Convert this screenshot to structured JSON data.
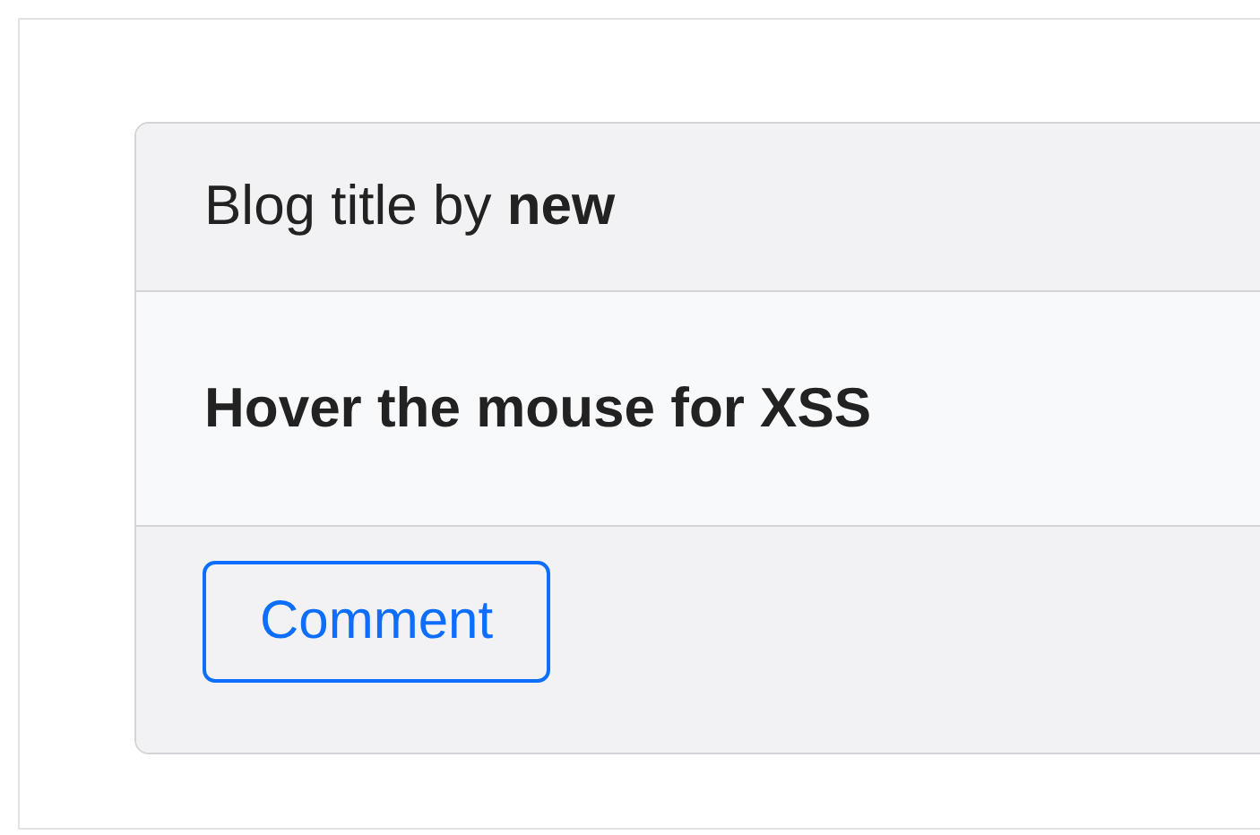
{
  "card": {
    "header": "Blog title by **new**",
    "body": "Hover the mouse for XSS",
    "footer_button": "Comment"
  }
}
